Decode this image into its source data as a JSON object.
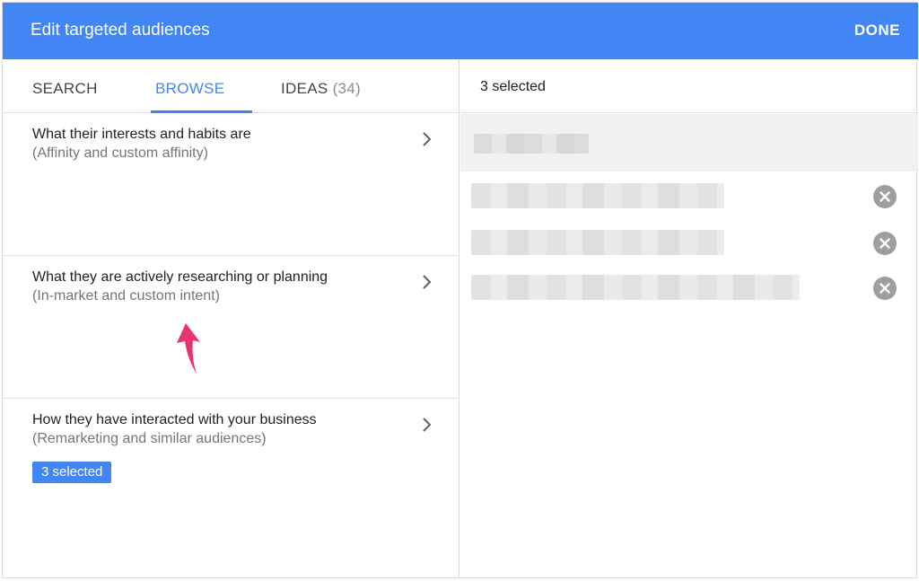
{
  "header": {
    "title": "Edit targeted audiences",
    "done_label": "DONE",
    "color": "#4285f4"
  },
  "tabs": [
    {
      "label": "SEARCH"
    },
    {
      "label": "BROWSE",
      "active": true
    },
    {
      "label": "IDEAS",
      "count": "(34)"
    }
  ],
  "categories": [
    {
      "title": "What their interests and habits are",
      "subtitle": "(Affinity and custom affinity)"
    },
    {
      "title": "What they are actively researching or planning",
      "subtitle": "(In-market and custom intent)"
    },
    {
      "title": "How they have interacted with your business",
      "subtitle": "(Remarketing and similar audiences)",
      "badge": "3 selected"
    }
  ],
  "selected_panel": {
    "count_label": "3 selected",
    "items": [
      {
        "icon": "remove-icon"
      },
      {
        "icon": "remove-icon"
      },
      {
        "icon": "remove-icon"
      }
    ]
  },
  "colors": {
    "accent": "#4285f4",
    "annotation_arrow": "#e8336d",
    "remove_icon": "#9e9e9e"
  }
}
